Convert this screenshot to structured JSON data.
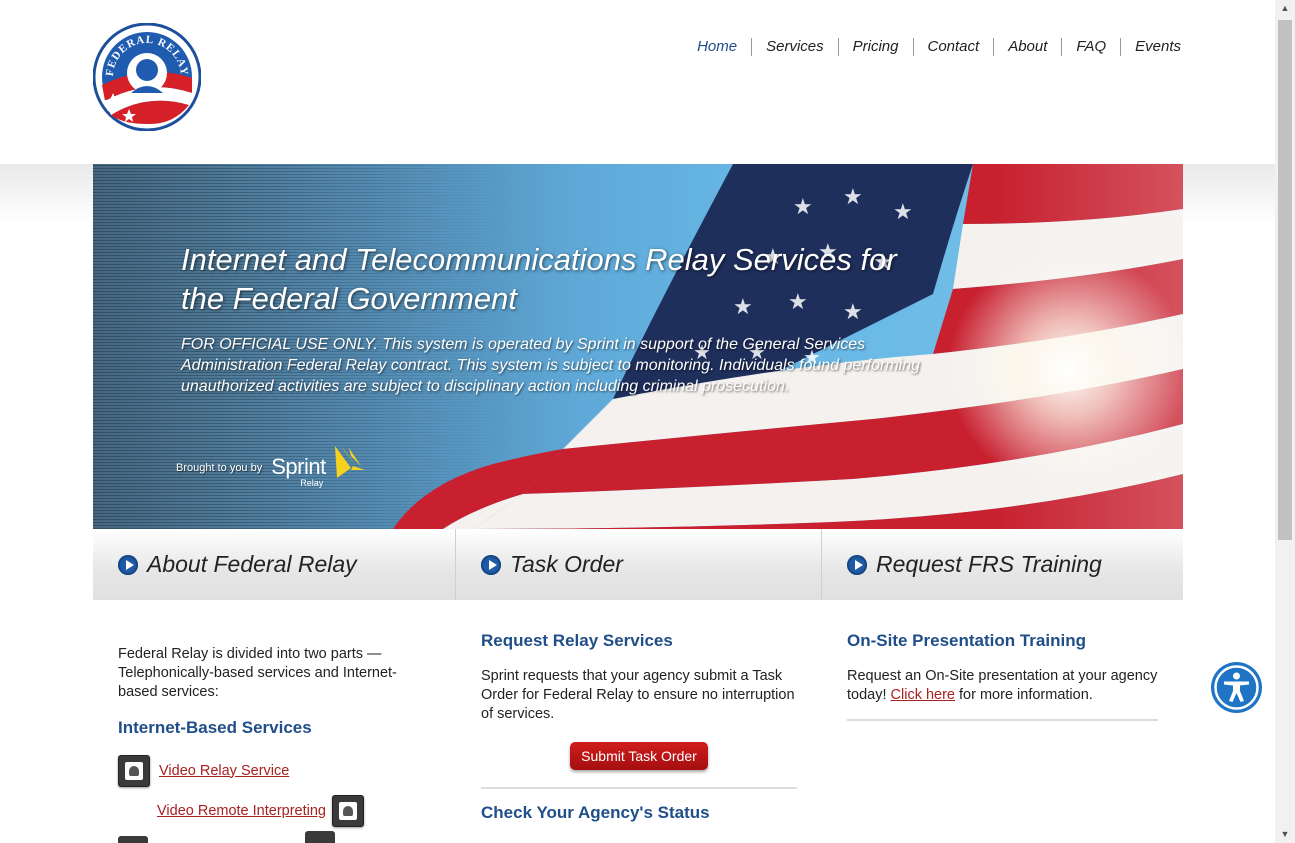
{
  "nav": {
    "items": [
      {
        "label": "Home",
        "active": true
      },
      {
        "label": "Services"
      },
      {
        "label": "Pricing"
      },
      {
        "label": "Contact"
      },
      {
        "label": "About"
      },
      {
        "label": "FAQ"
      },
      {
        "label": "Events"
      }
    ]
  },
  "logo": {
    "text": "FEDERAL RELAY"
  },
  "hero": {
    "title": "Internet and Telecommunications Relay Services for the Federal Government",
    "notice": "FOR OFFICIAL USE ONLY. This system is operated by Sprint in support of the General Services Administration Federal Relay contract. This system is subject to monitoring. Individuals found performing unauthorized activities are subject to disciplinary action including criminal prosecution.",
    "brought_by": "Brought to you by",
    "sprint_name": "Sprint",
    "sprint_sub": "Relay"
  },
  "tabs": [
    {
      "label": "About Federal Relay"
    },
    {
      "label": "Task Order"
    },
    {
      "label": "Request FRS Training"
    }
  ],
  "col1": {
    "intro": "Federal Relay is divided into two parts — Telephonically-based services and Internet-based services:",
    "heading": "Internet-Based Services",
    "services": [
      {
        "label": "Video Relay Service"
      },
      {
        "label": "Video Remote Interpreting"
      }
    ]
  },
  "col2": {
    "heading": "Request Relay Services",
    "text": "Sprint requests that your agency submit a Task Order for Federal Relay to ensure no interruption of services.",
    "button": "Submit Task Order",
    "heading2": "Check Your Agency's Status"
  },
  "col3": {
    "heading": "On-Site Presentation Training",
    "text_before": "Request an On-Site presentation at your agency today! ",
    "link": "Click here",
    "text_after": " for more information."
  },
  "colors": {
    "heading_blue": "#1f4e88",
    "link_red": "#a8211f",
    "button_red": "#c01616",
    "accessibility_blue": "#1f74c6"
  },
  "icons": [
    "play-circle-icon",
    "video-relay-icon",
    "video-interpreting-icon",
    "accessibility-icon",
    "sprint-logo",
    "federal-relay-logo"
  ]
}
